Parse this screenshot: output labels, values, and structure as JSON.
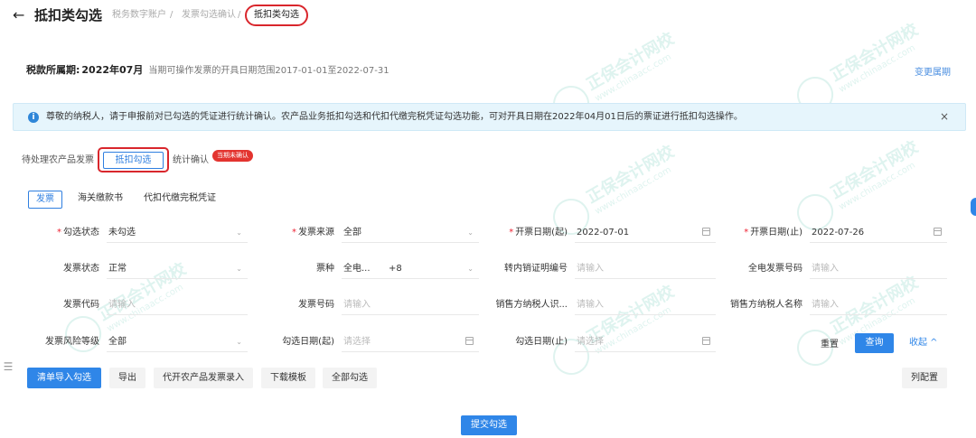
{
  "header": {
    "back_icon": "arrow-left-icon",
    "title": "抵扣类勾选",
    "breadcrumbs": [
      "税务数字账户",
      "发票勾选确认",
      "抵扣类勾选"
    ]
  },
  "period": {
    "label": "税款所属期:",
    "value": "2022年07月",
    "hint": "当期可操作发票的开具日期范围2017-01-01至2022-07-31",
    "change_link": "变更属期"
  },
  "notice": {
    "icon": "info-icon",
    "text": "尊敬的纳税人，请于申报前对已勾选的凭证进行统计确认。农产品业务抵扣勾选和代扣代缴完税凭证勾选功能，可对开具日期在2022年04月01日后的票证进行抵扣勾选操作。",
    "close": "×"
  },
  "tabs": [
    {
      "label": "待处理农产品发票"
    },
    {
      "label": "抵扣勾选"
    },
    {
      "label": "统计确认"
    }
  ],
  "tab_badge": "当期未确认",
  "subtabs": [
    "发票",
    "海关缴款书",
    "代扣代缴完税凭证"
  ],
  "filters": {
    "gxzt": {
      "label": "勾选状态",
      "value": "未勾选"
    },
    "fply": {
      "label": "发票来源",
      "value": "全部"
    },
    "kprq_q": {
      "label": "开票日期(起)",
      "value": "2022-07-01"
    },
    "kprq_z": {
      "label": "开票日期(止)",
      "value": "2022-07-26"
    },
    "fpzt": {
      "label": "发票状态",
      "value": "正常"
    },
    "pz": {
      "label": "票种",
      "value": "全电...",
      "extra": "+8"
    },
    "zrxz": {
      "label": "转内销证明编号",
      "placeholder": "请输入"
    },
    "qdfphm": {
      "label": "全电发票号码",
      "placeholder": "请输入"
    },
    "fpdm": {
      "label": "发票代码",
      "placeholder": "请输入"
    },
    "fphm": {
      "label": "发票号码",
      "placeholder": "请输入"
    },
    "xsfsbh": {
      "label": "销售方纳税人识...",
      "placeholder": "请输入"
    },
    "xsfmc": {
      "label": "销售方纳税人名称",
      "placeholder": "请输入"
    },
    "fxdj": {
      "label": "发票风险等级",
      "value": "全部"
    },
    "gxrq_q": {
      "label": "勾选日期(起)",
      "placeholder": "请选择"
    },
    "gxrq_z": {
      "label": "勾选日期(止)",
      "placeholder": "请选择"
    }
  },
  "query_buttons": {
    "reset": "重置",
    "query": "查询",
    "collapse": "收起 ^"
  },
  "actions": [
    "清单导入勾选",
    "导出",
    "代开农产品发票录入",
    "下载模板",
    "全部勾选"
  ],
  "column_config": "列配置",
  "submit": "提交勾选",
  "watermark": {
    "text": "正保会计网校",
    "url": "www.chinaacc.com"
  }
}
